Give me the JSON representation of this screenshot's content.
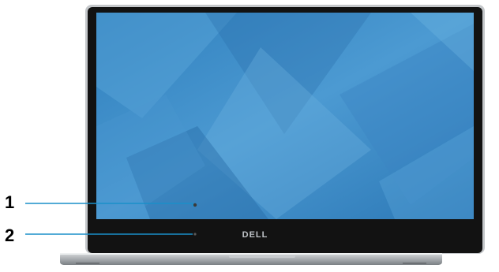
{
  "diagram": {
    "callouts": [
      {
        "number": "1"
      },
      {
        "number": "2"
      }
    ],
    "brand_logo_text": "DELL",
    "colors": {
      "callout_line": "#1a8fc9",
      "screen_blue": "#3d8fc9",
      "bezel": "#121212",
      "chassis": "#a9adb1"
    }
  }
}
